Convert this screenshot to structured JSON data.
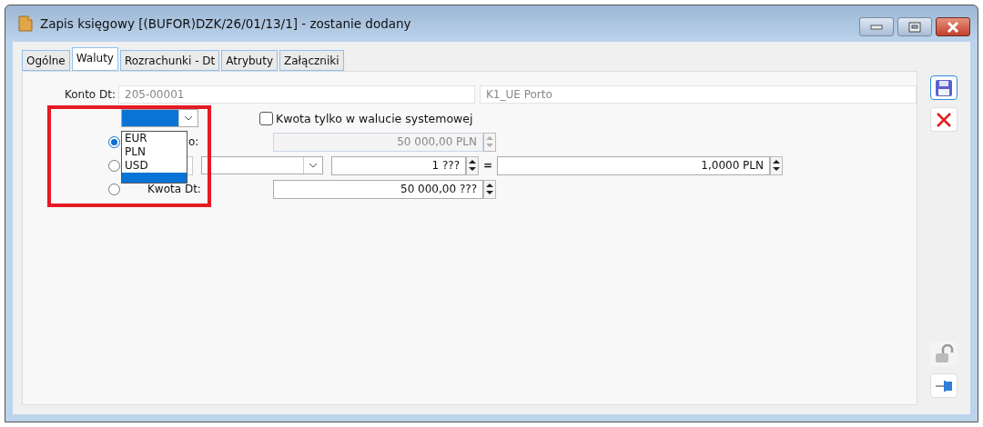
{
  "window": {
    "title": "Zapis księgowy [(BUFOR)DZK/26/01/13/1] - zostanie dodany"
  },
  "tabs": [
    {
      "label": "Ogólne",
      "selected": false
    },
    {
      "label": "Waluty",
      "selected": true
    },
    {
      "label": "Rozrachunki - Dt",
      "selected": false
    },
    {
      "label": "Atrybuty",
      "selected": false
    },
    {
      "label": "Załączniki",
      "selected": false
    }
  ],
  "account": {
    "label": "Konto Dt:",
    "number": "205-00001",
    "name": "K1_UE Porto"
  },
  "currency_combo": {
    "open": true,
    "empty_value_selected": true,
    "options": [
      {
        "label": "EUR",
        "selected": false
      },
      {
        "label": "PLN",
        "selected": false
      },
      {
        "label": "USD",
        "selected": false
      }
    ]
  },
  "system_currency_only": {
    "label": "Kwota tylko w walucie systemowej",
    "checked": false
  },
  "amount_row": {
    "selected": true,
    "label": "o:",
    "value": "50 000,00 PLN",
    "disabled": true
  },
  "rate_row": {
    "selected": false,
    "units": "1 ???",
    "equals": "=",
    "rate": "1,0000 PLN"
  },
  "currency_amount_row": {
    "selected": false,
    "label": "Kwota Dt:",
    "value": "50 000,00 ???",
    "disabled": false
  },
  "highlight": {
    "visible": true
  }
}
